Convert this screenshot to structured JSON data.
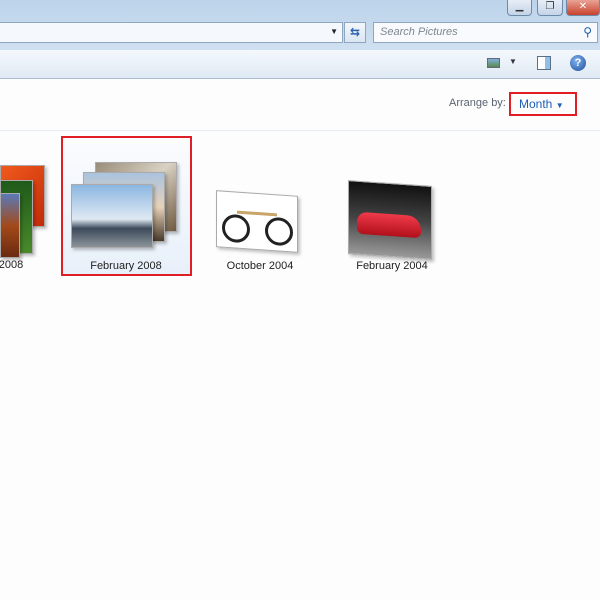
{
  "window": {
    "minimize_icon": "minimize-icon",
    "restore_icon": "restore-icon",
    "close_icon": "close-icon"
  },
  "address_bar": {
    "refresh_icon": "refresh-icon"
  },
  "search": {
    "placeholder": "Search Pictures",
    "icon": "search-icon"
  },
  "toolbar": {
    "view_icon": "change-view-icon",
    "preview_pane_icon": "preview-pane-icon",
    "help_icon": "help-icon"
  },
  "arrange": {
    "label": "Arrange by:",
    "value": "Month"
  },
  "groups": [
    {
      "label": "2008"
    },
    {
      "label": "February 2008",
      "selected": true
    },
    {
      "label": "October 2004"
    },
    {
      "label": "February 2004"
    }
  ],
  "colors": {
    "highlight": "#e01e25",
    "link": "#1e5fb8"
  }
}
